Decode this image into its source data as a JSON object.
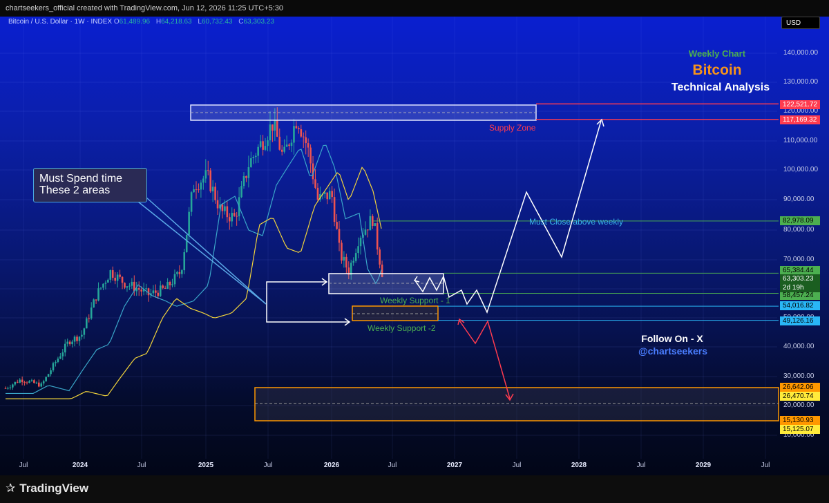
{
  "header": {
    "text": "chartseekers_official created with TradingView.com, Jun 12, 2026 11:25 UTC+5:30"
  },
  "currency": "USD",
  "legend": {
    "symbol": "Bitcoin / U.S. Dollar · 1W · INDEX",
    "o_label": "O",
    "o": "61,489.96",
    "h_label": "H",
    "h": "64,218.63",
    "l_label": "L",
    "l": "60,732.43",
    "c_label": "C",
    "c": "63,303.23"
  },
  "titles": {
    "weekly": "Weekly Chart",
    "bitcoin": "Bitcoin",
    "ta": "Technical Analysis",
    "follow": "Follow On - X",
    "handle": "@chartseekers"
  },
  "callout": {
    "line1": "Must Spend time",
    "line2": "These 2 areas"
  },
  "labels": {
    "supply": "Supply Zone",
    "ws1": "Weekly Support - 1",
    "ws2": "Weekly Support -2",
    "must_close": "Must Close above weekly"
  },
  "chart_data": {
    "type": "candlestick",
    "timeframe": "1W",
    "x_ticks": [
      "Jul",
      "2024",
      "Jul",
      "2025",
      "Jul",
      "2026",
      "Jul",
      "2027",
      "Jul",
      "2028",
      "Jul",
      "2029",
      "Jul"
    ],
    "y_ticks": [
      "140,000.00",
      "130,000.00",
      "120,000.00",
      "110,000.00",
      "100,000.00",
      "90,000.00",
      "80,000.00",
      "70,000.00",
      "60,000.00",
      "50,000.00",
      "40,000.00",
      "30,000.00",
      "20,000.00",
      "10,000.00"
    ],
    "y_range": [
      10000,
      140000
    ],
    "last_close": 63303.23,
    "candle_countdown": "2d 19h",
    "levels": [
      {
        "label": "122,521.72",
        "color": "#ff3b4f"
      },
      {
        "label": "117,169.32",
        "color": "#ff3b4f"
      },
      {
        "label": "82,978.09",
        "color": "#4caf50"
      },
      {
        "label": "65,384.44",
        "color": "#4caf50"
      },
      {
        "label": "63,303.23",
        "color": "#1b5e20"
      },
      {
        "label": "58,457.24",
        "color": "#4caf50"
      },
      {
        "label": "54,016.82",
        "color": "#29b6f6"
      },
      {
        "label": "49,126.16",
        "color": "#29b6f6"
      },
      {
        "label": "26,642.06",
        "color": "#ff9800"
      },
      {
        "label": "26,470.74",
        "color": "#ffeb3b"
      },
      {
        "label": "15,130.93",
        "color": "#ff9800"
      },
      {
        "label": "15,125.07",
        "color": "#ffeb3b"
      }
    ],
    "zones": [
      "Supply Zone",
      "Weekly Support - 1",
      "Weekly Support -2"
    ],
    "colors": {
      "up": "#26a69a",
      "down": "#ef5350",
      "ma_fast": "#3aa6c9",
      "ma_slow": "#f2d43b"
    }
  },
  "footer": {
    "brand": "TradingView"
  }
}
